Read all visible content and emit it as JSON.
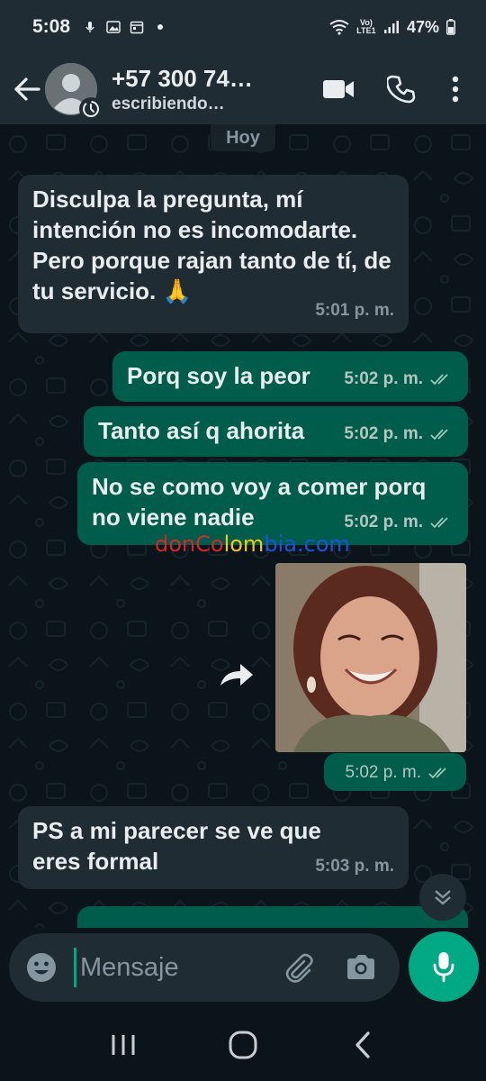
{
  "status_bar": {
    "time": "5:08",
    "network_label": "Vo) LTE1",
    "battery": "47%"
  },
  "header": {
    "contact_name": "+57 300 74…",
    "status": "escribiendo…",
    "icons": [
      "back-arrow-icon",
      "avatar-icon",
      "video-call-icon",
      "phone-icon",
      "more-vert-icon"
    ]
  },
  "chat": {
    "day_label": "Hoy",
    "messages": [
      {
        "direction": "in",
        "text": "Disculpa la pregunta, mí intención no es incomodarte. Pero porque rajan tanto de tí, de tu servicio. 🙏",
        "time": "5:01 p. m."
      },
      {
        "direction": "out",
        "text": "Porq soy la peor",
        "time": "5:02 p. m.",
        "read": true
      },
      {
        "direction": "out",
        "text": "Tanto así q ahorita",
        "time": "5:02 p. m.",
        "read": true
      },
      {
        "direction": "out",
        "text": "No se como voy a comer porq no viene nadie",
        "time": "5:02 p. m.",
        "read": true
      },
      {
        "direction": "out",
        "type": "image",
        "time": "5:02 p. m.",
        "read": true
      },
      {
        "direction": "in",
        "text": "PS a mi parecer se ve que eres formal",
        "time": "5:03 p. m."
      }
    ],
    "watermark": {
      "part1": "donCo",
      "part2": "lom",
      "part3": "bia.com"
    }
  },
  "composer": {
    "placeholder": "Mensaje"
  },
  "colors": {
    "background": "#0b141a",
    "header": "#1f2c34",
    "incoming_bubble": "#202c33",
    "outgoing_bubble": "#005c4b",
    "accent": "#00a884"
  }
}
